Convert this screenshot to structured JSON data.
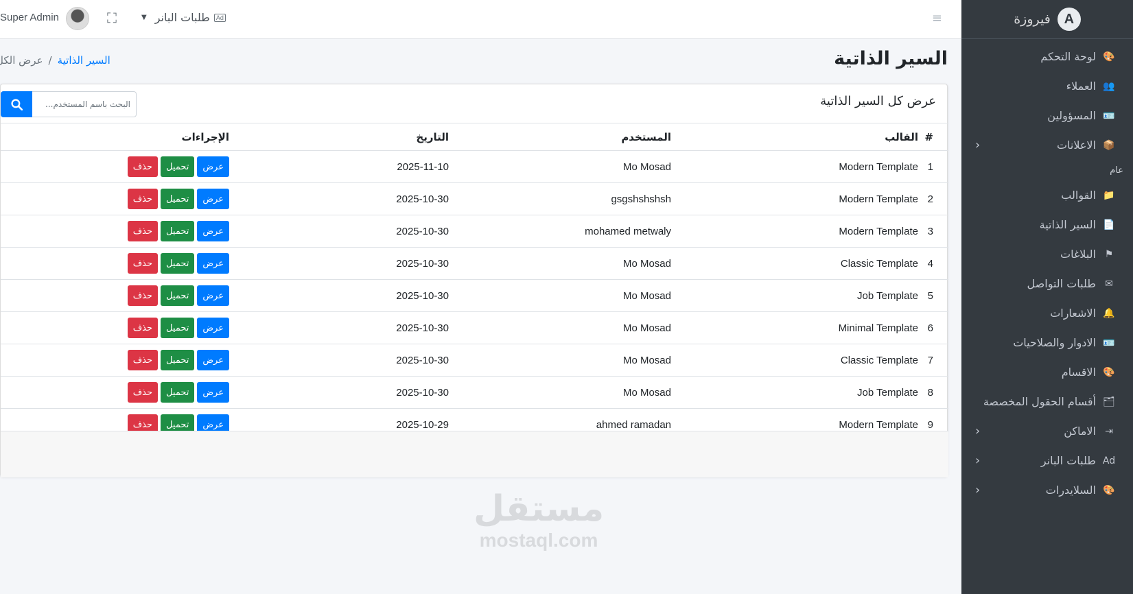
{
  "brand": {
    "name": "فيروزة",
    "logo_letter": "A"
  },
  "sidebar": {
    "items": [
      {
        "label": "لوحة التحكم",
        "icon": "palette-icon",
        "glyph": "🎨",
        "chevron": false
      },
      {
        "label": "العملاء",
        "icon": "users-icon",
        "glyph": "👥",
        "chevron": false
      },
      {
        "label": "المسؤولين",
        "icon": "id-card-icon",
        "glyph": "🪪",
        "chevron": false
      },
      {
        "label": "الاعلانات",
        "icon": "cube-icon",
        "glyph": "📦",
        "chevron": true
      }
    ],
    "section_header": "عام",
    "items2": [
      {
        "label": "القوالب",
        "icon": "folder-icon",
        "glyph": "📁",
        "chevron": false
      },
      {
        "label": "السير الذاتية",
        "icon": "file-user-icon",
        "glyph": "📄",
        "chevron": false
      },
      {
        "label": "البلاغات",
        "icon": "flag-icon",
        "glyph": "⚑",
        "chevron": false
      },
      {
        "label": "طلبات التواصل",
        "icon": "envelope-icon",
        "glyph": "✉",
        "chevron": false
      },
      {
        "label": "الاشعارات",
        "icon": "bell-icon",
        "glyph": "🔔",
        "chevron": false
      },
      {
        "label": "الادوار والصلاحيات",
        "icon": "id-badge-icon",
        "glyph": "🪪",
        "chevron": false
      },
      {
        "label": "الاقسام",
        "icon": "palette-icon",
        "glyph": "🎨",
        "chevron": false
      },
      {
        "label": "أقسام الحقول المخصصة",
        "icon": "folder-plus-icon",
        "glyph": "🗂",
        "chevron": false
      },
      {
        "label": "الاماكن",
        "icon": "sign-in-icon",
        "glyph": "⇥",
        "chevron": true
      },
      {
        "label": "طلبات البانر",
        "icon": "ad-icon",
        "glyph": "Ad",
        "chevron": true
      },
      {
        "label": "السلايدرات",
        "icon": "palette-icon",
        "glyph": "🎨",
        "chevron": true
      }
    ]
  },
  "topbar": {
    "banner_dropdown": "طلبات البانر",
    "ad_badge": "Ad",
    "user_name": "Super Admin"
  },
  "page": {
    "title": "السير الذاتية",
    "breadcrumb_link": "السير الذاتية",
    "breadcrumb_separator": "/",
    "breadcrumb_current": "عرض الكل"
  },
  "card": {
    "title": "عرض كل السير الذاتية",
    "search_placeholder": "البحث باسم المستخدم..."
  },
  "table": {
    "headers": [
      "#",
      "القالب",
      "المستخدم",
      "التاريخ",
      "الإجراءات"
    ],
    "rows": [
      [
        "1",
        "Modern Template",
        "Mo Mosad",
        "2025-11-10"
      ],
      [
        "2",
        "Modern Template",
        "gsgshshshsh",
        "2025-10-30"
      ],
      [
        "3",
        "Modern Template",
        "mohamed metwaly",
        "2025-10-30"
      ],
      [
        "4",
        "Classic Template",
        "Mo Mosad",
        "2025-10-30"
      ],
      [
        "5",
        "Job Template",
        "Mo Mosad",
        "2025-10-30"
      ],
      [
        "6",
        "Minimal Template",
        "Mo Mosad",
        "2025-10-30"
      ],
      [
        "7",
        "Classic Template",
        "Mo Mosad",
        "2025-10-30"
      ],
      [
        "8",
        "Job Template",
        "Mo Mosad",
        "2025-10-30"
      ],
      [
        "9",
        "Modern Template",
        "ahmed ramadan",
        "2025-10-29"
      ]
    ],
    "actions": {
      "view": "عرض",
      "download": "تحميل",
      "delete": "حذف"
    }
  },
  "colors": {
    "primary": "#007bff",
    "success": "#28a745",
    "danger": "#dc3545",
    "sidebar": "#343a40"
  },
  "watermark": {
    "ar": "مستقل",
    "en": "mostaql.com"
  }
}
